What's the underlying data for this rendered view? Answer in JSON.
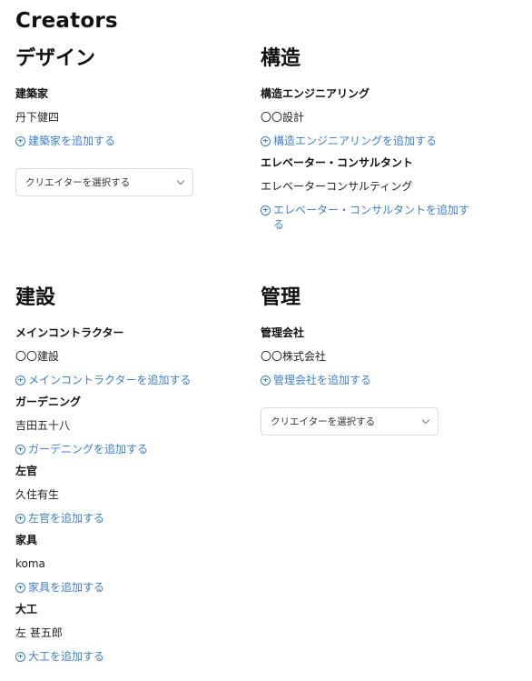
{
  "page_title": "Creators",
  "sections": {
    "design": {
      "heading": "デザイン",
      "roles": [
        {
          "title": "建築家",
          "value": "丹下健四",
          "add": "建築家を追加する"
        }
      ],
      "select_placeholder": "クリエイターを選択する"
    },
    "structure": {
      "heading": "構造",
      "roles": [
        {
          "title": "構造エンジニアリング",
          "value": "〇〇設計",
          "add": "構造エンジニアリングを追加する"
        },
        {
          "title": "エレベーター・コンサルタント",
          "value": "エレベーターコンサルティング",
          "add": "エレベーター・コンサルタントを追加する"
        }
      ]
    },
    "construction": {
      "heading": "建設",
      "roles": [
        {
          "title": "メインコントラクター",
          "value": "〇〇建設",
          "add": "メインコントラクターを追加する"
        },
        {
          "title": "ガーデニング",
          "value": "吉田五十八",
          "add": "ガーデニングを追加する"
        },
        {
          "title": "左官",
          "value": "久住有生",
          "add": "左官を追加する"
        },
        {
          "title": "家具",
          "value": "koma",
          "add": "家具を追加する"
        },
        {
          "title": "大工",
          "value": "左 甚五郎",
          "add": "大工を追加する"
        }
      ]
    },
    "management": {
      "heading": "管理",
      "roles": [
        {
          "title": "管理会社",
          "value": "〇〇株式会社",
          "add": "管理会社を追加する"
        }
      ],
      "select_placeholder": "クリエイターを選択する"
    }
  },
  "colors": {
    "link": "#3b7fd6",
    "text": "#111111"
  },
  "icons": {
    "add": "plus-circle-icon",
    "dropdown": "chevron-down-icon"
  }
}
